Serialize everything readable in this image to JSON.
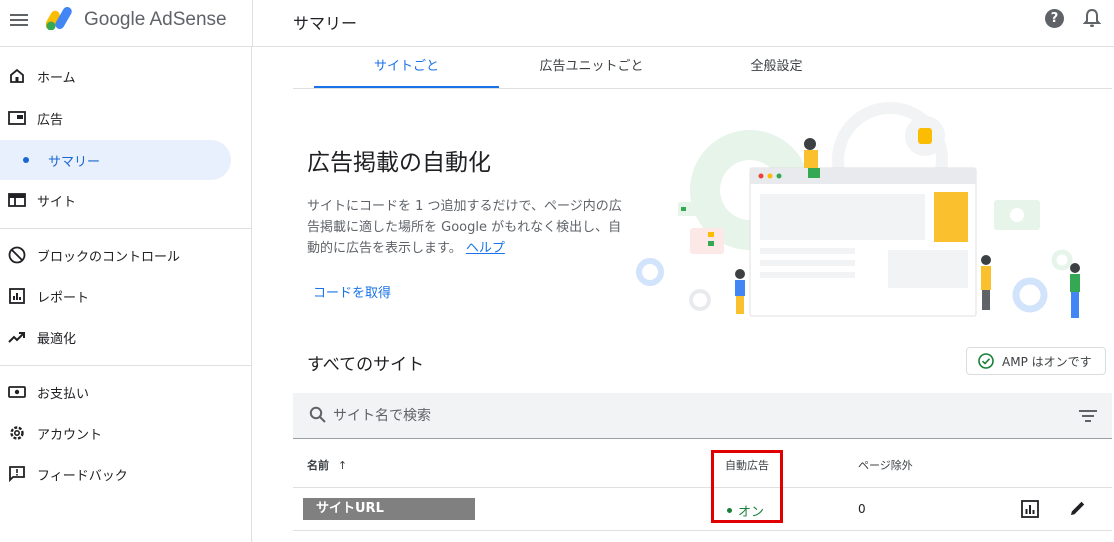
{
  "brand": {
    "name": "Google AdSense"
  },
  "header": {
    "title": "サマリー"
  },
  "sidebar": {
    "items": [
      {
        "label": "ホーム",
        "icon": "home-icon"
      },
      {
        "label": "広告",
        "icon": "ads-icon"
      },
      {
        "label": "サマリー",
        "active": true
      },
      {
        "label": "サイト",
        "icon": "sites-icon"
      },
      {
        "label": "ブロックのコントロール",
        "icon": "block-icon"
      },
      {
        "label": "レポート",
        "icon": "report-icon"
      },
      {
        "label": "最適化",
        "icon": "trending-icon"
      },
      {
        "label": "お支払い",
        "icon": "payments-icon"
      },
      {
        "label": "アカウント",
        "icon": "gear-icon"
      },
      {
        "label": "フィードバック",
        "icon": "feedback-icon"
      }
    ]
  },
  "tabs": [
    {
      "label": "サイトごと",
      "active": true
    },
    {
      "label": "広告ユニットごと"
    },
    {
      "label": "全般設定"
    }
  ],
  "hero": {
    "title": "広告掲載の自動化",
    "description": "サイトにコードを 1 つ追加するだけで、ページ内の広告掲載に適した場所を Google がもれなく検出し、自動的に広告を表示します。",
    "help_link": "ヘルプ",
    "get_code": "コードを取得"
  },
  "sites": {
    "title": "すべてのサイト",
    "amp_chip": "AMP はオンです",
    "search_placeholder": "サイト名で検索",
    "columns": {
      "name": "名前",
      "auto_ads": "自動広告",
      "page_exclusions": "ページ除外"
    },
    "rows": [
      {
        "name": "サイトURL",
        "auto_ads": "オン",
        "page_exclusions": "0"
      }
    ]
  },
  "colors": {
    "accent": "#1a73e8",
    "on_status": "#188038",
    "highlight": "#e00000"
  }
}
